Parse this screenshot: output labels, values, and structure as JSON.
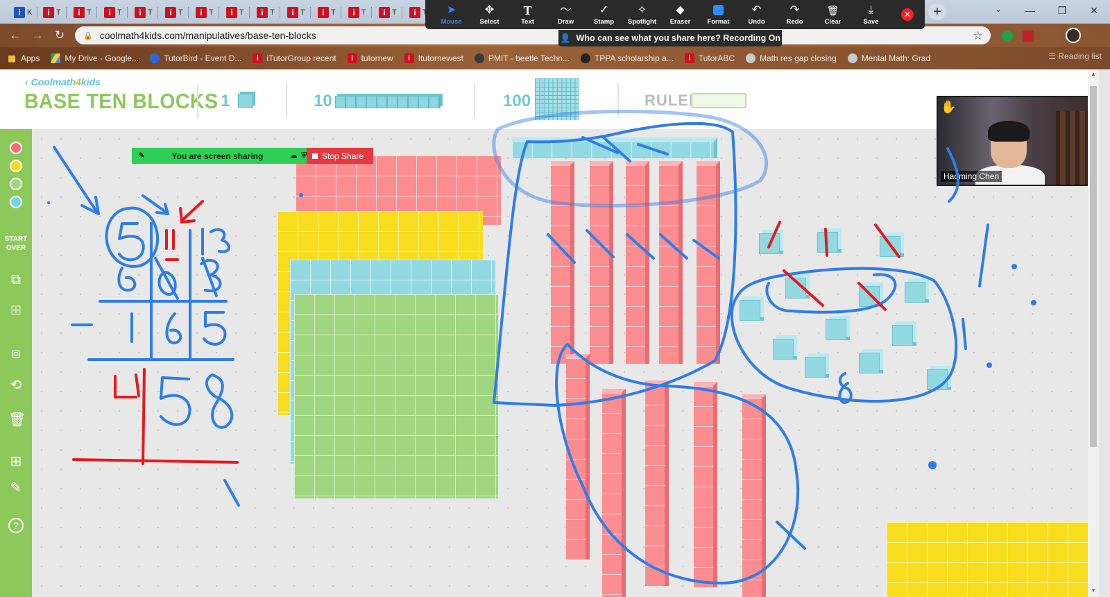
{
  "browser": {
    "tab_title_letter": "T",
    "first_tab_letter": "K",
    "url": "coolmath4kids.com/manipulatives/base-ten-blocks",
    "bookmarks": [
      {
        "label": "Apps",
        "icon": "apps-grid-icon"
      },
      {
        "label": "My Drive - Google...",
        "icon": "google-drive-icon"
      },
      {
        "label": "TutorBird - Event D...",
        "icon": "tutorbird-icon"
      },
      {
        "label": "iTutorGroup recent",
        "icon": "itutor-icon"
      },
      {
        "label": "tutornew",
        "icon": "itutor-icon"
      },
      {
        "label": "Itutornewest",
        "icon": "itutor-icon"
      },
      {
        "label": "PMIT - beetle Techn...",
        "icon": "beetle-icon"
      },
      {
        "label": "TPPA scholarship a...",
        "icon": "tppa-icon"
      },
      {
        "label": "TutorABC",
        "icon": "itutor-icon"
      },
      {
        "label": "Math res gap closing",
        "icon": "globe-icon"
      },
      {
        "label": "Mental Math: Grad",
        "icon": "globe-icon"
      }
    ],
    "reading_list": "Reading list"
  },
  "annotate_toolbar": {
    "tools": [
      {
        "label": "Mouse",
        "icon": "mouse-pointer-icon",
        "glyph": "➤",
        "active": true
      },
      {
        "label": "Select",
        "icon": "select-move-icon",
        "glyph": "✥"
      },
      {
        "label": "Text",
        "icon": "text-icon",
        "glyph": "T"
      },
      {
        "label": "Draw",
        "icon": "draw-icon",
        "glyph": "〜"
      },
      {
        "label": "Stamp",
        "icon": "stamp-icon",
        "glyph": "✓"
      },
      {
        "label": "Spotlight",
        "icon": "spotlight-icon",
        "glyph": "✧"
      },
      {
        "label": "Eraser",
        "icon": "eraser-icon",
        "glyph": "◆"
      },
      {
        "label": "Format",
        "icon": "format-icon",
        "glyph": ""
      },
      {
        "label": "Undo",
        "icon": "undo-icon",
        "glyph": "↶"
      },
      {
        "label": "Redo",
        "icon": "redo-icon",
        "glyph": "↷"
      },
      {
        "label": "Clear",
        "icon": "trash-icon",
        "glyph": "🗑"
      },
      {
        "label": "Save",
        "icon": "save-icon",
        "glyph": "⤓"
      }
    ],
    "close_icon": "close-icon",
    "accent": "#2d8cff"
  },
  "share_notice": "Who can see what you share here? Recording On",
  "app": {
    "brand": "Coolmath4kids",
    "brand_pre": "Coolmath",
    "brand_four": "4",
    "brand_post": "kids",
    "title": "BASE TEN BLOCKS",
    "block_labels": [
      "1",
      "10",
      "100"
    ],
    "ruler_label": "RULER",
    "start_over": "START OVER",
    "colors": {
      "green": "#8cc85a",
      "red": "#fb8d90",
      "yellow": "#f8dc1e",
      "blue": "#93d9e2"
    }
  },
  "screen_share": {
    "status": "You are screen sharing",
    "stop": "Stop Share"
  },
  "video": {
    "participant": "Haoming Chen"
  }
}
